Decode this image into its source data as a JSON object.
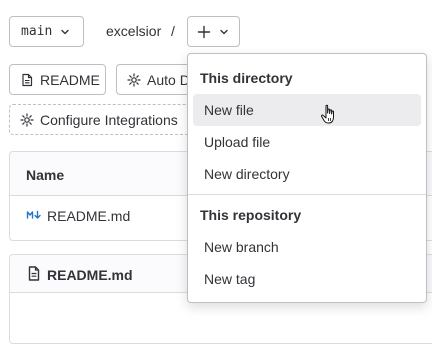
{
  "toolbar": {
    "branch_label": "main",
    "repo_path": "excelsior",
    "path_separator": "/",
    "add_symbol": "+"
  },
  "actions": {
    "readme_label": "README",
    "auto_devops_label": "Auto D",
    "configure_integrations_label": "Configure Integrations"
  },
  "file_table": {
    "header_name": "Name",
    "rows": [
      {
        "name": "README.md",
        "icon": "markdown-icon"
      }
    ]
  },
  "readme_panel": {
    "title": "README.md",
    "icon": "file-icon"
  },
  "dropdown": {
    "sections": [
      {
        "header": "This directory",
        "items": [
          "New file",
          "Upload file",
          "New directory"
        ]
      },
      {
        "header": "This repository",
        "items": [
          "New branch",
          "New tag"
        ]
      }
    ],
    "hovered_item": "New file"
  },
  "colors": {
    "text": "#333238",
    "border": "#bfbfc3",
    "hover_bg": "#ececef",
    "markdown_icon": "#1f75cb"
  }
}
